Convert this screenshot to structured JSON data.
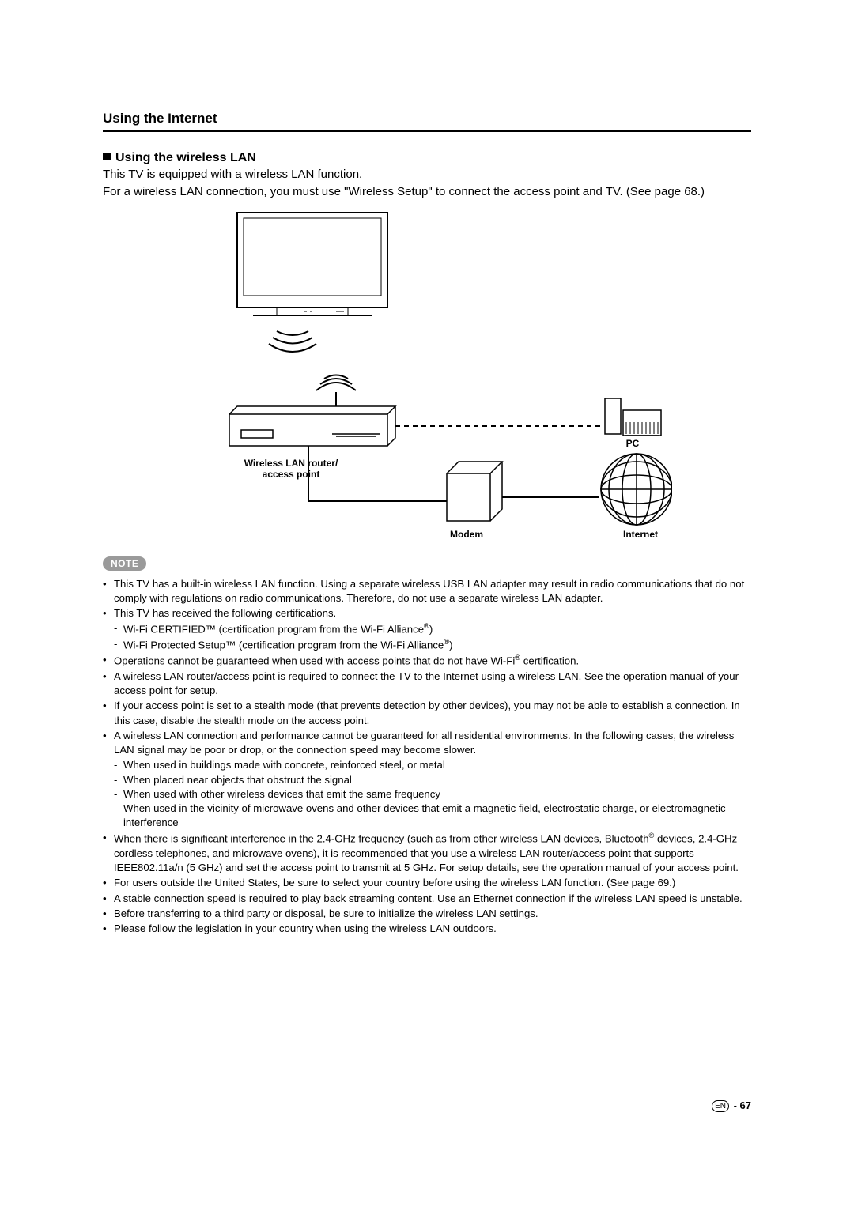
{
  "section_title": "Using the Internet",
  "subhead": "Using the wireless LAN",
  "intro_line1": "This TV is equipped with a wireless LAN function.",
  "intro_line2": "For a wireless LAN connection, you must use \"Wireless Setup\" to connect the access point and TV. (See page 68.)",
  "diagram": {
    "router_label": "Wireless LAN router/\naccess point",
    "pc_label": "PC",
    "modem_label": "Modem",
    "internet_label": "Internet"
  },
  "note_label": "NOTE",
  "notes": [
    {
      "text": "This TV has a built-in wireless LAN function. Using a separate wireless USB LAN adapter may result in radio communications that do not comply with regulations on radio communications. Therefore, do not use a separate wireless LAN adapter."
    },
    {
      "text": "This TV has received the following certifications.",
      "sub": [
        "Wi-Fi CERTIFIED™ (certification program from the Wi-Fi Alliance®)",
        "Wi-Fi Protected Setup™ (certification program from the Wi-Fi Alliance®)"
      ]
    },
    {
      "text": "Operations cannot be guaranteed when used with access points that do not have Wi-Fi® certification."
    },
    {
      "text": "A wireless LAN router/access point is required to connect the TV to the Internet using a wireless LAN. See the operation manual of your access point for setup."
    },
    {
      "text": "If your access point is set to a stealth mode (that prevents detection by other devices), you may not be able to establish a connection. In this case, disable the stealth mode on the access point."
    },
    {
      "text": "A wireless LAN connection and performance cannot be guaranteed for all residential environments. In the following cases, the wireless LAN signal may be poor or drop, or the connection speed may become slower.",
      "sub": [
        "When used in buildings made with concrete, reinforced steel, or metal",
        "When placed near objects that obstruct the signal",
        "When used with other wireless devices that emit the same frequency",
        "When used in the vicinity of microwave ovens and other devices that emit a magnetic field, electrostatic charge, or electromagnetic interference"
      ]
    },
    {
      "text": "When there is significant interference in the 2.4-GHz frequency (such as from other wireless LAN devices, Bluetooth® devices, 2.4-GHz cordless telephones, and microwave ovens), it is recommended that you use a wireless LAN router/access point that supports IEEE802.11a/n (5 GHz) and set the access point to transmit at 5 GHz. For setup details, see the operation manual of your access point."
    },
    {
      "text": "For users outside the United States, be sure to select your country before using the wireless LAN function. (See page 69.)"
    },
    {
      "text": "A stable connection speed is required to play back streaming content. Use an Ethernet connection if the wireless LAN speed is unstable."
    },
    {
      "text": "Before transferring to a third party or disposal, be sure to initialize the wireless LAN settings."
    },
    {
      "text": "Please follow the legislation in your country when using the wireless LAN outdoors."
    }
  ],
  "footer": {
    "lang": "EN",
    "sep": " - ",
    "page": "67"
  }
}
